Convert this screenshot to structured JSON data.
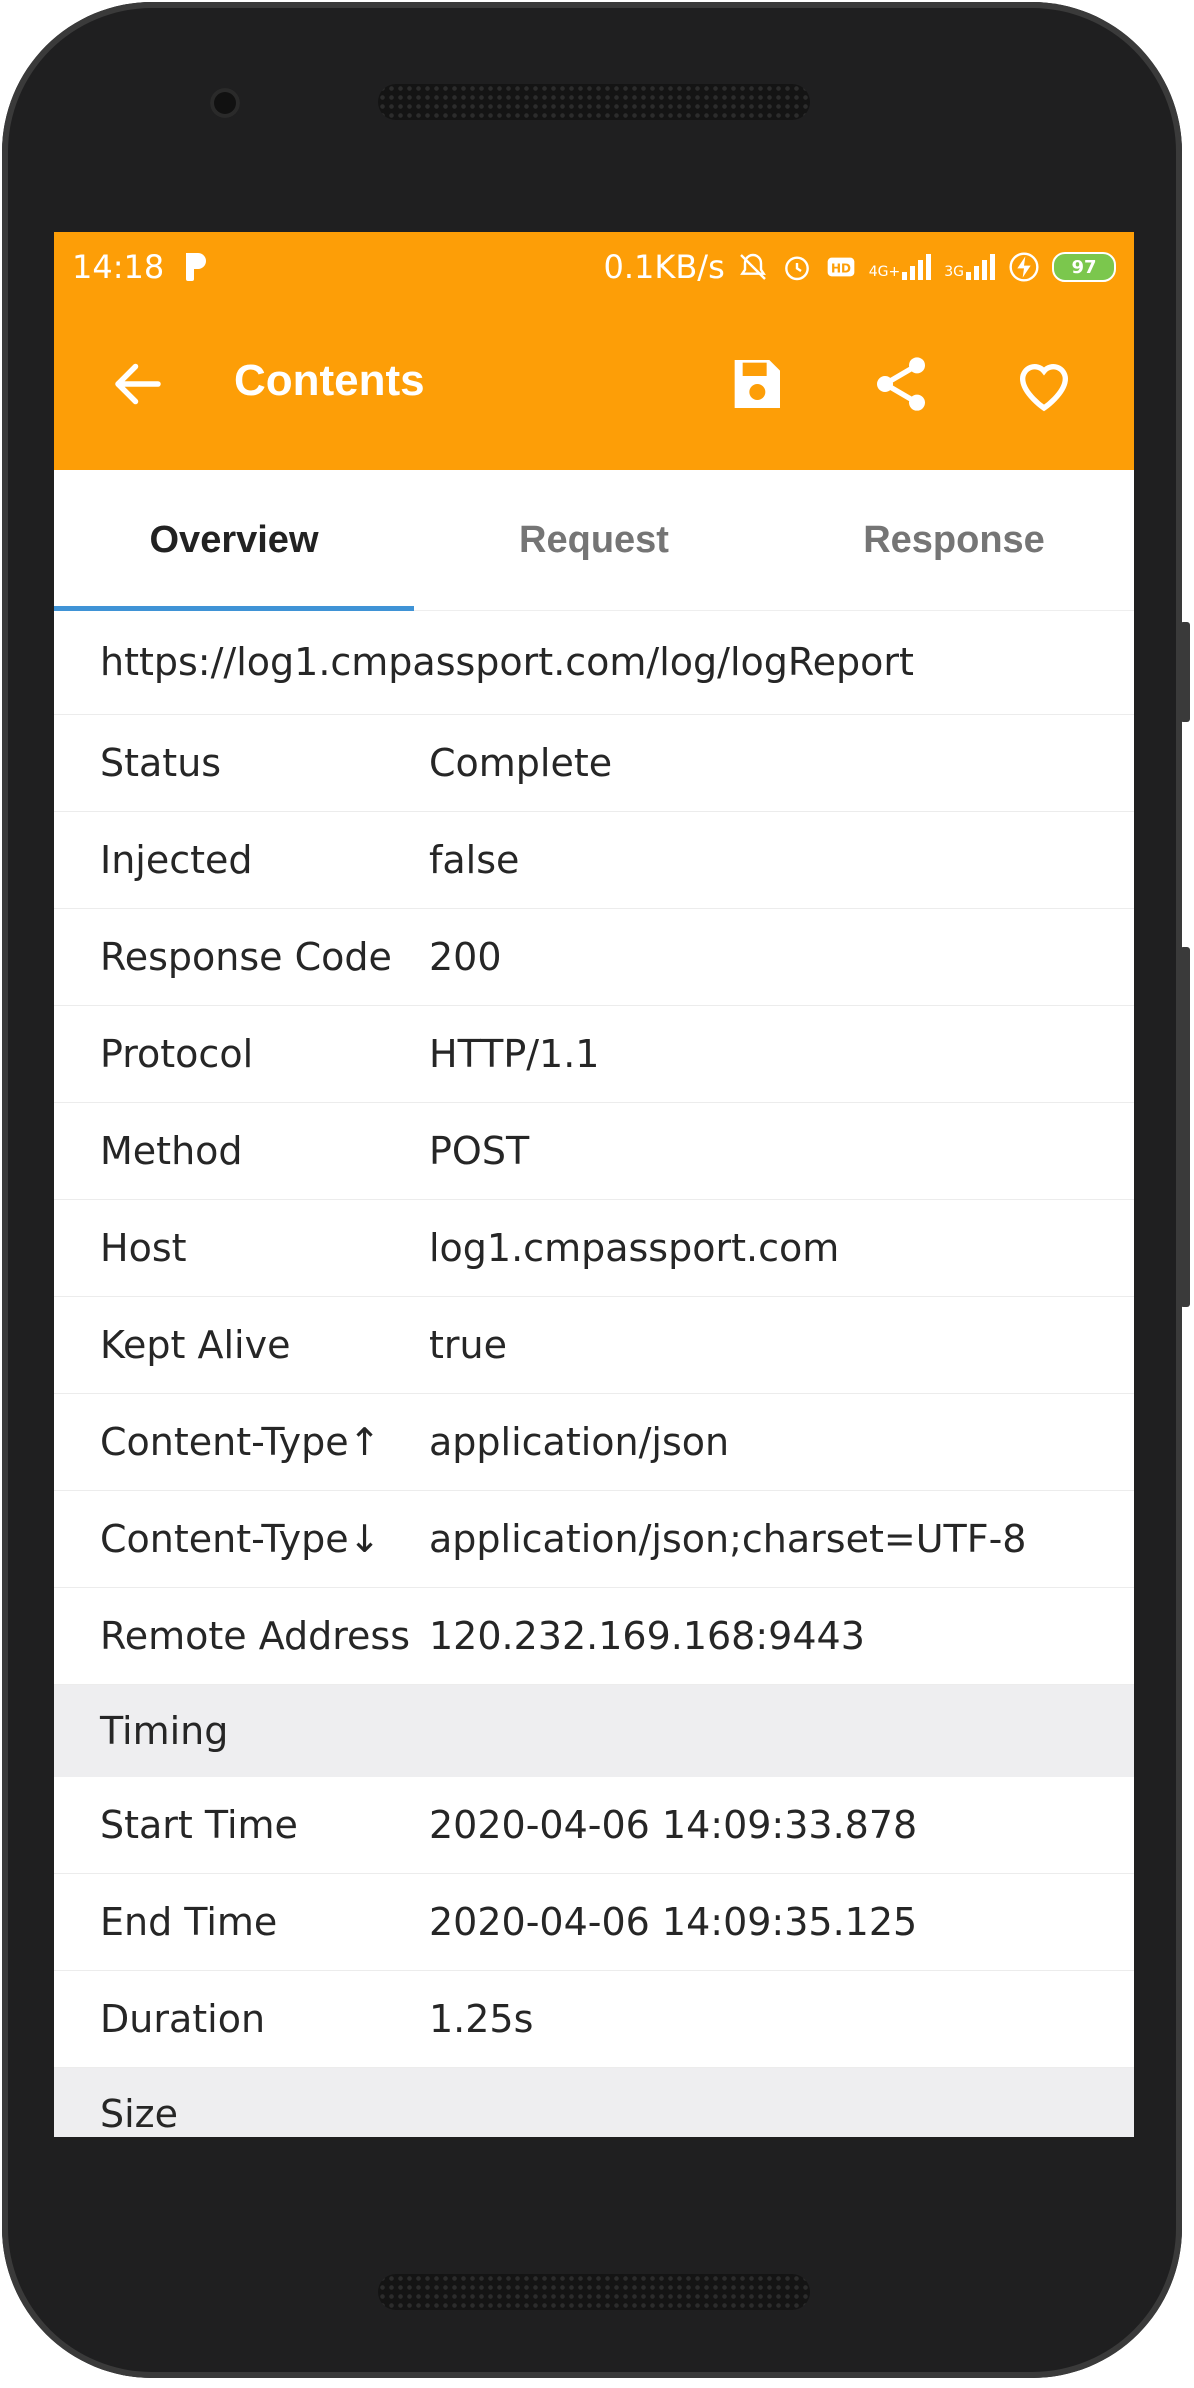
{
  "statusbar": {
    "time": "14:18",
    "speed": "0.1KB/s",
    "battery": "97",
    "net_4g": "4G+",
    "net_3g": "3G"
  },
  "appbar": {
    "title": "Contents",
    "color": "#fd9e07"
  },
  "tabs": [
    {
      "label": "Overview",
      "active": true
    },
    {
      "label": "Request",
      "active": false
    },
    {
      "label": "Response",
      "active": false
    }
  ],
  "overview": {
    "url": "https://log1.cmpassport.com/log/logReport",
    "rows": [
      {
        "key": "Status",
        "value": "Complete"
      },
      {
        "key": "Injected",
        "value": "false"
      },
      {
        "key": "Response Code",
        "value": "200"
      },
      {
        "key": "Protocol",
        "value": "HTTP/1.1"
      },
      {
        "key": "Method",
        "value": "POST"
      },
      {
        "key": "Host",
        "value": "log1.cmpassport.com"
      },
      {
        "key": "Kept Alive",
        "value": "true"
      },
      {
        "key": "Content-Type↑",
        "value": "application/json"
      },
      {
        "key": "Content-Type↓",
        "value": "application/json;charset=UTF-8"
      },
      {
        "key": "Remote Address",
        "value": "120.232.169.168:9443"
      }
    ]
  },
  "timing": {
    "section_label": "Timing",
    "rows": [
      {
        "key": "Start Time",
        "value": "2020-04-06 14:09:33.878"
      },
      {
        "key": "End Time",
        "value": "2020-04-06 14:09:35.125"
      },
      {
        "key": "Duration",
        "value": "1.25s"
      }
    ]
  },
  "size": {
    "section_label": "Size"
  }
}
